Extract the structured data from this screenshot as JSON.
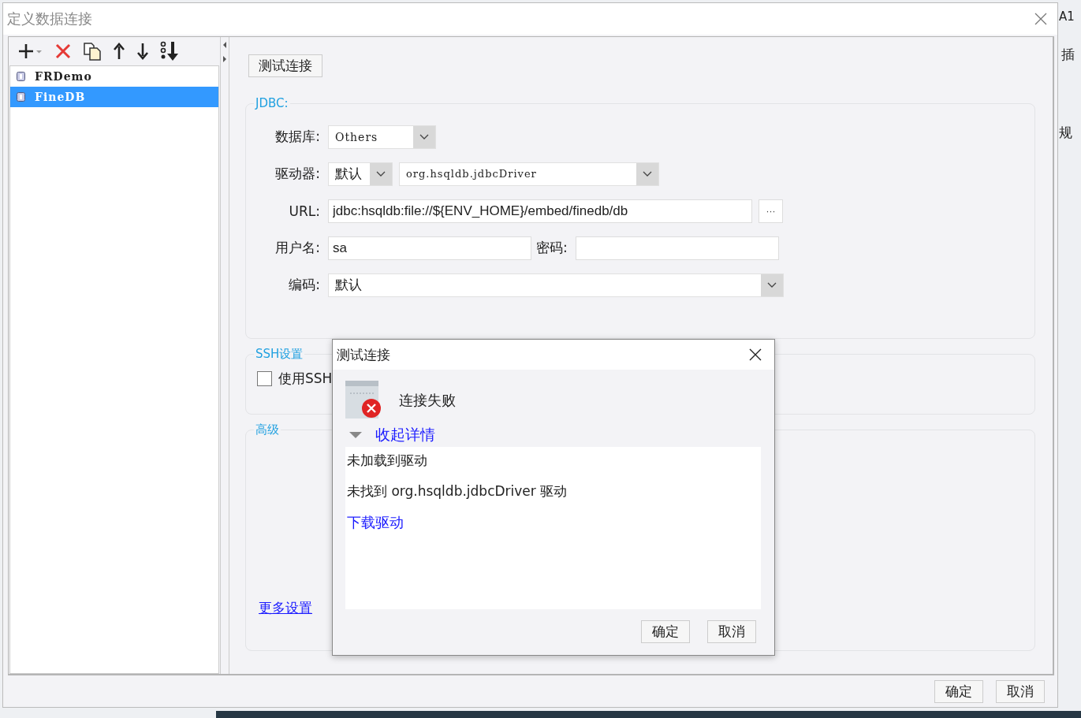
{
  "window": {
    "title": "定义数据连接"
  },
  "connections": [
    {
      "name": "FRDemo",
      "selected": false
    },
    {
      "name": "FineDB",
      "selected": true
    }
  ],
  "test_button": "测试连接",
  "jdbc": {
    "legend": "JDBC:",
    "database": {
      "label": "数据库:",
      "value": "Others"
    },
    "driver": {
      "label": "驱动器:",
      "mode": "默认",
      "value": "org.hsqldb.jdbcDriver"
    },
    "url": {
      "label": "URL:",
      "value": "jdbc:hsqldb:file://${ENV_HOME}/embed/finedb/db",
      "browse": "···"
    },
    "user": {
      "label": "用户名:",
      "value": "sa"
    },
    "password": {
      "label": "密码:"
    },
    "encoding": {
      "label": "编码:",
      "value": "默认"
    }
  },
  "ssh": {
    "legend": "SSH设置",
    "checkbox": {
      "label": "使用SSH",
      "checked": false
    }
  },
  "advanced": {
    "legend": "高级",
    "more_link": "更多设置"
  },
  "buttons": [
    "确定",
    "取消"
  ],
  "test_dialog": {
    "title": "测试连接",
    "status": "连接失败",
    "toggle": "收起详情",
    "expanded": true,
    "details": [
      "未加载到驱动",
      "未找到 org.hsqldb.jdbcDriver 驱动"
    ],
    "download_link": "下载驱动",
    "buttons": [
      "确定",
      "取消"
    ]
  },
  "background_app": [
    "A1",
    "插",
    "规"
  ]
}
